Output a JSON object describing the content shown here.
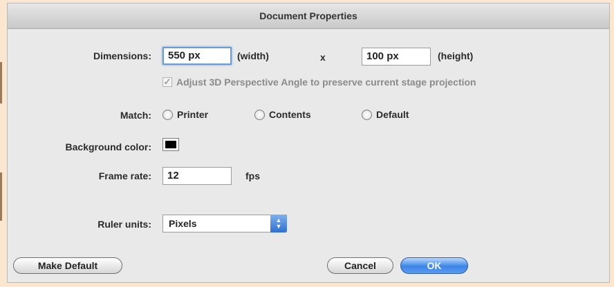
{
  "window": {
    "title": "Document Properties"
  },
  "dimensions": {
    "label": "Dimensions:",
    "width_value": "550 px",
    "width_suffix": "(width)",
    "times": "x",
    "height_value": "100 px",
    "height_suffix": "(height)"
  },
  "adjust3d": {
    "label": "Adjust 3D Perspective Angle to preserve current stage projection",
    "checked": true
  },
  "match": {
    "label": "Match:",
    "options": [
      "Printer",
      "Contents",
      "Default"
    ]
  },
  "background": {
    "label": "Background color:",
    "color": "#000000"
  },
  "frame_rate": {
    "label": "Frame rate:",
    "value": "12",
    "unit": "fps"
  },
  "ruler_units": {
    "label": "Ruler units:",
    "selected": "Pixels"
  },
  "buttons": {
    "make_default": "Make Default",
    "cancel": "Cancel",
    "ok": "OK"
  },
  "colors": {
    "accent": "#3c85e6",
    "background": "#e9e9e9"
  }
}
